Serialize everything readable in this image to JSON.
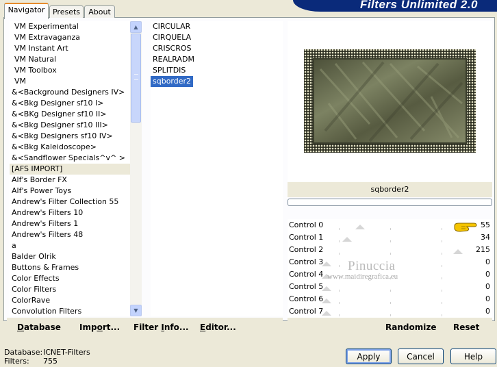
{
  "window": {
    "title": "Filters Unlimited 2.0"
  },
  "tabs": [
    {
      "label": "Navigator",
      "active": true
    },
    {
      "label": "Presets",
      "active": false
    },
    {
      "label": "About",
      "active": false
    }
  ],
  "categories": [
    "VM Experimental",
    "VM Extravaganza",
    "VM Instant Art",
    "VM Natural",
    "VM Toolbox",
    "VM",
    "&<Background Designers IV>",
    "&<Bkg Designer sf10 I>",
    "&<BKg Designer sf10 II>",
    "&<Bkg Designer sf10 III>",
    "&<Bkg Designers sf10 IV>",
    "&<Bkg Kaleidoscope>",
    "&<Sandflower Specials^v^ >",
    "[AFS IMPORT]",
    "Alf's Border FX",
    "Alf's Power Toys",
    "Andrew's Filter Collection 55",
    "Andrew's Filters 10",
    "Andrew's Filters 1",
    "Andrew's Filters 48",
    "a",
    "Balder Olrik",
    "Buttons & Frames",
    "Color Effects",
    "Color Filters",
    "ColorRave",
    "Convolution Filters"
  ],
  "selected_category": "[AFS IMPORT]",
  "filters": [
    "CIRCULAR",
    "CIRQUELA",
    "CRISCROS",
    "REALRADM",
    "SPLITDIS",
    "sqborder2"
  ],
  "selected_filter": "sqborder2",
  "preview": {
    "filter_name": "sqborder2"
  },
  "controls": [
    {
      "label": "Control 0",
      "value": "55",
      "level": 55
    },
    {
      "label": "Control 1",
      "value": "34",
      "level": 34
    },
    {
      "label": "Control 2",
      "value": "215",
      "level": 215
    },
    {
      "label": "Control 3",
      "value": "0",
      "level": 0
    },
    {
      "label": "Control 4",
      "value": "0",
      "level": 0
    },
    {
      "label": "Control 5",
      "value": "0",
      "level": 0
    },
    {
      "label": "Control 6",
      "value": "0",
      "level": 0
    },
    {
      "label": "Control 7",
      "value": "0",
      "level": 0
    }
  ],
  "watermark": {
    "name": "Pinuccia",
    "url": "www.maidiregrafica.eu"
  },
  "toolbar_left": {
    "database": {
      "u": "D",
      "rest": "atabase"
    },
    "import": {
      "pre": "Imp",
      "u": "o",
      "rest": "rt..."
    },
    "filter_info": {
      "pre": "Filter ",
      "u": "I",
      "rest": "nfo..."
    },
    "editor": {
      "u": "E",
      "rest": "ditor..."
    }
  },
  "toolbar_right": {
    "randomize": "Randomize",
    "reset": "Reset"
  },
  "status": {
    "database_label": "Database:",
    "database_value": "ICNET-Filters",
    "filters_label": "Filters:",
    "filters_value": "755"
  },
  "buttons": {
    "apply": "Apply",
    "cancel": "Cancel",
    "help": "Help"
  },
  "icons": {
    "up": "scroll-up-arrow",
    "down": "scroll-down-arrow",
    "pointer": "pointing-hand"
  },
  "colors": {
    "selection": "#316ac5",
    "banner": "#0a2a7a",
    "preview_frame": "#3a3d2c",
    "preview_fill": "#6f7554"
  }
}
